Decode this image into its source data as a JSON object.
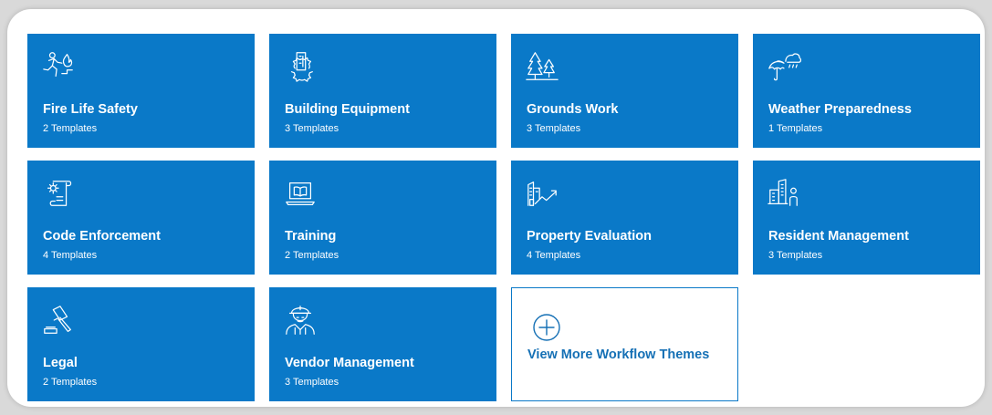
{
  "colors": {
    "tile_bg": "#0a79c8",
    "tile_text": "#ffffff",
    "link": "#1570b5",
    "page_bg": "#d9d9d9"
  },
  "themes": [
    {
      "title": "Fire Life Safety",
      "count": "2 Templates",
      "icon": "fire-escape-icon"
    },
    {
      "title": "Building Equipment",
      "count": "3 Templates",
      "icon": "building-gear-icon"
    },
    {
      "title": "Grounds Work",
      "count": "3 Templates",
      "icon": "trees-icon"
    },
    {
      "title": "Weather Preparedness",
      "count": "1 Templates",
      "icon": "umbrella-rain-icon"
    },
    {
      "title": "Code Enforcement",
      "count": "4 Templates",
      "icon": "gear-scroll-icon"
    },
    {
      "title": "Training",
      "count": "2 Templates",
      "icon": "laptop-book-icon"
    },
    {
      "title": "Property Evaluation",
      "count": "4 Templates",
      "icon": "building-trend-icon"
    },
    {
      "title": "Resident Management",
      "count": "3 Templates",
      "icon": "building-person-icon"
    },
    {
      "title": "Legal",
      "count": "2 Templates",
      "icon": "gavel-icon"
    },
    {
      "title": "Vendor Management",
      "count": "3 Templates",
      "icon": "worker-icon"
    }
  ],
  "more": {
    "label": "View More Workflow Themes",
    "icon": "plus-circle-icon"
  }
}
